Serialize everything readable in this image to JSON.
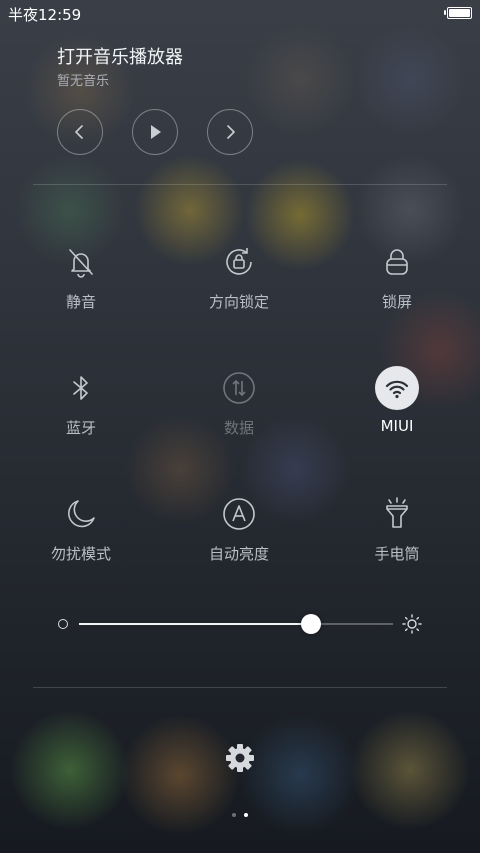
{
  "status_bar": {
    "time": "半夜12:59",
    "battery_icon": "battery-full-icon",
    "battery_level": 1.0
  },
  "music": {
    "title": "打开音乐播放器",
    "subtitle": "暂无音乐",
    "controls": [
      "previous-icon",
      "play-icon",
      "next-icon"
    ]
  },
  "toggles": [
    {
      "label": "静音",
      "icon": "silent-bell-icon",
      "state": "off"
    },
    {
      "label": "方向锁定",
      "icon": "rotation-lock-icon",
      "state": "off"
    },
    {
      "label": "锁屏",
      "icon": "lock-icon",
      "state": "off"
    },
    {
      "label": "蓝牙",
      "icon": "bluetooth-icon",
      "state": "off"
    },
    {
      "label": "数据",
      "icon": "mobile-data-icon",
      "state": "disabled"
    },
    {
      "label": "MIUI",
      "icon": "wifi-icon",
      "state": "on"
    },
    {
      "label": "勿扰模式",
      "icon": "moon-icon",
      "state": "off"
    },
    {
      "label": "自动亮度",
      "icon": "auto-brightness-icon",
      "state": "off"
    },
    {
      "label": "手电筒",
      "icon": "flashlight-icon",
      "state": "off"
    }
  ],
  "brightness": {
    "level": 0.74,
    "min_icon": "brightness-low-icon",
    "max_icon": "brightness-high-icon"
  },
  "settings_icon": "gear-icon",
  "pager": {
    "pages": 2,
    "current": 2
  },
  "colors": {
    "active_toggle_bg": "#e6e8eb",
    "label": "#b9bfc7",
    "disabled_label": "#6e747c"
  }
}
